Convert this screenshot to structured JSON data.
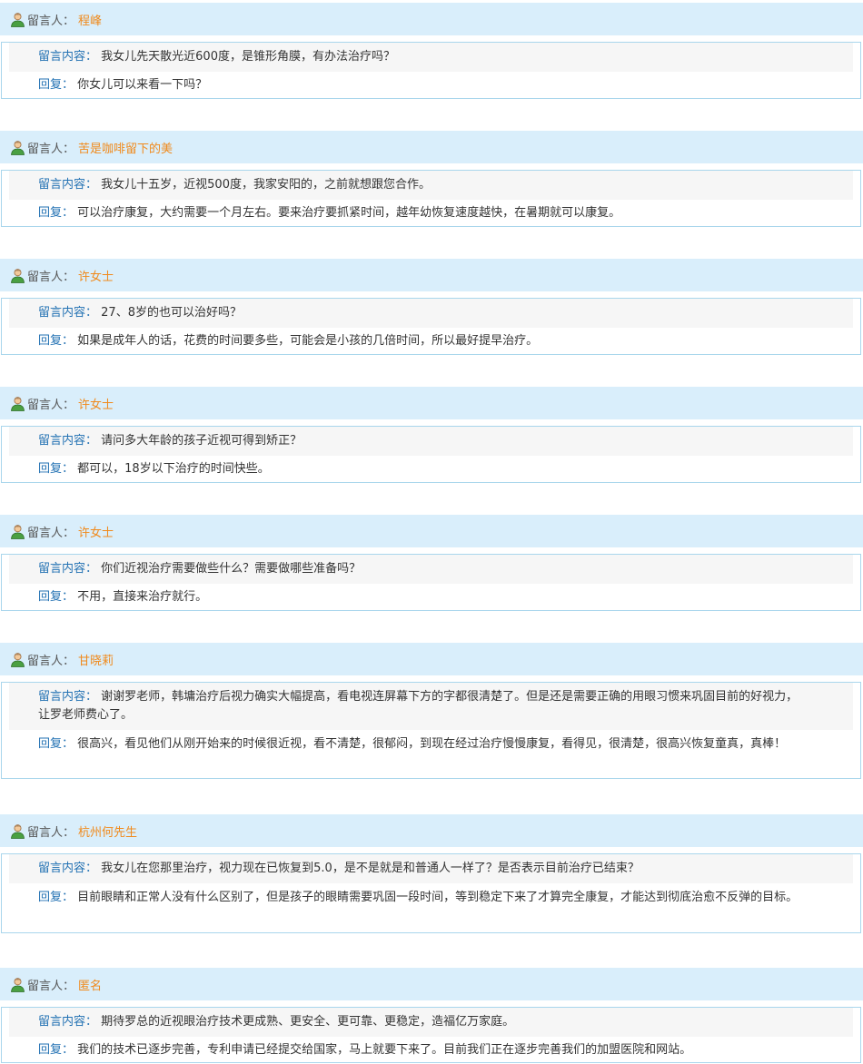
{
  "labels": {
    "author_label": "留言人：",
    "question_label": "留言内容：",
    "reply_label": "回复："
  },
  "colors": {
    "header_bg": "#d9eefb",
    "username": "#f08a1c",
    "key_text": "#2271b3",
    "border": "#a9d6ec"
  },
  "icons": {
    "author": "user-avatar-icon"
  },
  "entries": [
    {
      "author": "程峰",
      "question": "我女儿先天散光近600度，是锥形角膜，有办法治疗吗？",
      "reply": "你女儿可以来看一下吗？"
    },
    {
      "author": "苦是咖啡留下的美",
      "question": "我女儿十五岁，近视500度，我家安阳的，之前就想跟您合作。",
      "reply": "可以治疗康复，大约需要一个月左右。要来治疗要抓紧时间，越年幼恢复速度越快，在暑期就可以康复。"
    },
    {
      "author": "许女士",
      "question": "27、8岁的也可以治好吗？",
      "reply": "如果是成年人的话，花费的时间要多些，可能会是小孩的几倍时间，所以最好提早治疗。"
    },
    {
      "author": "许女士",
      "question": "请问多大年龄的孩子近视可得到矫正？",
      "reply": "都可以，18岁以下治疗的时间快些。"
    },
    {
      "author": "许女士",
      "question": "你们近视治疗需要做些什么？需要做哪些准备吗？",
      "reply": "不用，直接来治疗就行。"
    },
    {
      "author": "甘晓莉",
      "question": "谢谢罗老师，韩墉治疗后视力确实大幅提高，看电视连屏幕下方的字都很清楚了。但是还是需要正确的用眼习惯来巩固目前的好视力，让罗老师费心了。",
      "reply": "很高兴，看见他们从刚开始来的时候很近视，看不清楚，很郁闷，到现在经过治疗慢慢康复，看得见，很清楚，很高兴恢复童真，真棒！"
    },
    {
      "author": "杭州何先生",
      "question": "我女儿在您那里治疗，视力现在已恢复到5.0，是不是就是和普通人一样了？是否表示目前治疗已结束？",
      "reply": "目前眼睛和正常人没有什么区别了，但是孩子的眼睛需要巩固一段时间，等到稳定下来了才算完全康复，才能达到彻底治愈不反弹的目标。"
    },
    {
      "author": "匿名",
      "question": "期待罗总的近视眼治疗技术更成熟、更安全、更可靠、更稳定，造福亿万家庭。",
      "reply": "我们的技术已逐步完善，专利申请已经提交给国家，马上就要下来了。目前我们正在逐步完善我们的加盟医院和网站。"
    }
  ]
}
